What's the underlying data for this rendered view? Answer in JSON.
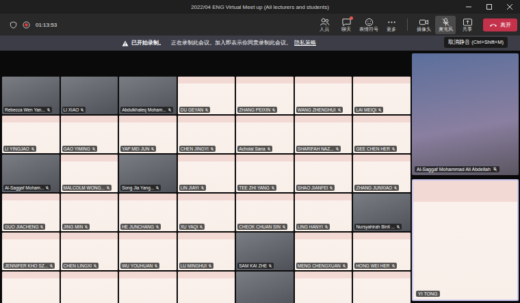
{
  "window": {
    "title": "2022/04 ENG Virtual Meet up (All lecturers and students)"
  },
  "meeting": {
    "timer": "01:13:53",
    "recording": true
  },
  "actions": [
    {
      "label": "人员",
      "badge": false
    },
    {
      "label": "聊天",
      "badge": true
    },
    {
      "label": "表情符号",
      "badge": false
    },
    {
      "label": "更多",
      "badge": false
    }
  ],
  "devices": [
    {
      "label": "摄像头",
      "off": false,
      "highlighted": false
    },
    {
      "label": "麦克风",
      "off": true,
      "highlighted": true
    },
    {
      "label": "共享",
      "off": false,
      "highlighted": false
    }
  ],
  "leave": {
    "label": "离开"
  },
  "tooltip": {
    "text": "取消静音 (Ctrl+Shift+M)"
  },
  "notice": {
    "title": "已开始录制。",
    "text": "正在录制此会议。加入即表示你同意录制此会议。",
    "link": "隐私策略"
  },
  "grid": [
    {
      "name": "Rebecca Wen Yan...",
      "kind": "camera",
      "muted": true
    },
    {
      "name": "LI XIAO",
      "kind": "camera",
      "muted": true
    },
    {
      "name": "Abdulkhaleq Moham...",
      "kind": "camera",
      "muted": true
    },
    {
      "name": "DU GEYAN",
      "kind": "banner",
      "muted": true
    },
    {
      "name": "ZHANG PEIXIN",
      "kind": "banner",
      "muted": true
    },
    {
      "name": "WANG ZHENGHUI",
      "kind": "banner",
      "muted": true
    },
    {
      "name": "LAI MEIQI",
      "kind": "banner",
      "muted": true
    },
    {
      "name": "LI YINGJAO",
      "kind": "banner",
      "muted": true
    },
    {
      "name": "GAO YIMING",
      "kind": "banner",
      "muted": true
    },
    {
      "name": "YAP MEI JUN",
      "kind": "banner",
      "muted": true
    },
    {
      "name": "CHEN JINGYI",
      "kind": "banner",
      "muted": true
    },
    {
      "name": "Achoiai Sana",
      "kind": "banner",
      "muted": true
    },
    {
      "name": "SHARIFAH NAZ...",
      "kind": "banner",
      "muted": true
    },
    {
      "name": "GEE CHEN HER",
      "kind": "banner",
      "muted": true
    },
    {
      "name": "Al-Saggaf Moham...",
      "kind": "camera",
      "muted": true
    },
    {
      "name": "MALCOLM WONG...",
      "kind": "banner",
      "muted": true
    },
    {
      "name": "Song Jia Yang...",
      "kind": "camera",
      "muted": true
    },
    {
      "name": "LIN JIAYI",
      "kind": "banner",
      "muted": true
    },
    {
      "name": "TEE ZHI YANG",
      "kind": "banner",
      "muted": true
    },
    {
      "name": "SHAO JIANFEI",
      "kind": "banner",
      "muted": true
    },
    {
      "name": "ZHANG JUNXIAO",
      "kind": "banner",
      "muted": true
    },
    {
      "name": "GUO JIACHENG",
      "kind": "banner",
      "muted": true
    },
    {
      "name": "JING MIN",
      "kind": "banner",
      "muted": true
    },
    {
      "name": "HE JUNCHANG",
      "kind": "banner",
      "muted": true
    },
    {
      "name": "XU YAQI",
      "kind": "banner",
      "muted": true
    },
    {
      "name": "CHEOK CHUAN SIN",
      "kind": "banner",
      "muted": true
    },
    {
      "name": "LING HANYI",
      "kind": "banner",
      "muted": true
    },
    {
      "name": "Nursyahirah Binti ...",
      "kind": "camera",
      "muted": true
    },
    {
      "name": "JENNIFER KHO SZ...",
      "kind": "banner",
      "muted": true
    },
    {
      "name": "CHEN LINGXI",
      "kind": "banner",
      "muted": true
    },
    {
      "name": "WU YOUHUAN",
      "kind": "banner",
      "muted": true
    },
    {
      "name": "LU MINGHUI",
      "kind": "banner",
      "muted": true
    },
    {
      "name": "SAM KAI ZHE",
      "kind": "camera",
      "muted": true
    },
    {
      "name": "MENG CHENGXUAN",
      "kind": "banner",
      "muted": true
    },
    {
      "name": "HONG WEI HER",
      "kind": "banner",
      "muted": true
    },
    {
      "kind": "banner",
      "muted": false
    },
    {
      "kind": "banner",
      "muted": false
    },
    {
      "kind": "banner",
      "muted": false
    },
    {
      "kind": "banner",
      "muted": false
    },
    {
      "kind": "camera",
      "muted": false
    },
    {
      "kind": "banner",
      "muted": false
    },
    {
      "kind": "banner",
      "muted": false
    }
  ],
  "spotlight": [
    {
      "name": "Al-Saggaf Mohammad Ali Abdellah",
      "kind": "camera",
      "muted": true,
      "speaking": false
    },
    {
      "name": "YI TONG",
      "kind": "banner",
      "muted": false,
      "speaking": true
    }
  ]
}
